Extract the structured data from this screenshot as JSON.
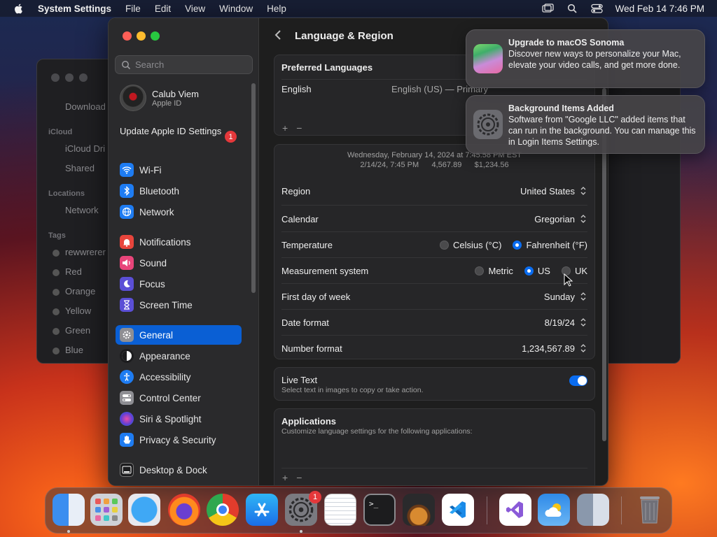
{
  "menubar": {
    "app_name": "System Settings",
    "menus": [
      "File",
      "Edit",
      "View",
      "Window",
      "Help"
    ],
    "datetime": "Wed Feb 14  7:46 PM"
  },
  "finder": {
    "items": [
      "Download",
      "iCloud Dri",
      "Shared",
      "Network"
    ],
    "sections": [
      "iCloud",
      "Locations",
      "Tags"
    ],
    "tags": [
      "rewwrerer",
      "Red",
      "Orange",
      "Yellow",
      "Green",
      "Blue"
    ]
  },
  "sidebar": {
    "search_placeholder": "Search",
    "profile": {
      "name": "Calub Viem",
      "sub": "Apple ID"
    },
    "update": {
      "label": "Update Apple ID Settings",
      "badge": "1"
    },
    "items": [
      {
        "label": "Wi-Fi",
        "icon": "wifi-icon",
        "color": "#1e7cf2"
      },
      {
        "label": "Bluetooth",
        "icon": "bluetooth-icon",
        "color": "#1e7cf2"
      },
      {
        "label": "Network",
        "icon": "globe-icon",
        "color": "#1e7cf2"
      },
      {
        "label": "Notifications",
        "icon": "bell-icon",
        "color": "#e8453c"
      },
      {
        "label": "Sound",
        "icon": "speaker-icon",
        "color": "#e8457a"
      },
      {
        "label": "Focus",
        "icon": "moon-icon",
        "color": "#5b4fd6"
      },
      {
        "label": "Screen Time",
        "icon": "hourglass-icon",
        "color": "#5b4fd6"
      },
      {
        "label": "General",
        "icon": "gear-icon",
        "color": "#8e8e93"
      },
      {
        "label": "Appearance",
        "icon": "appearance-icon",
        "color": "#1c1c1e"
      },
      {
        "label": "Accessibility",
        "icon": "accessibility-icon",
        "color": "#1e7cf2"
      },
      {
        "label": "Control Center",
        "icon": "toggles-icon",
        "color": "#8e8e93"
      },
      {
        "label": "Siri & Spotlight",
        "icon": "siri-icon",
        "color": "#6a3fd1"
      },
      {
        "label": "Privacy & Security",
        "icon": "hand-icon",
        "color": "#1e7cf2"
      },
      {
        "label": "Desktop & Dock",
        "icon": "dock-icon",
        "color": "#1c1c1e"
      }
    ],
    "selected": "General"
  },
  "content": {
    "title": "Language & Region",
    "preferred_languages": {
      "heading": "Preferred Languages",
      "language": "English",
      "language_detail": "English (US) — Primary"
    },
    "preview": {
      "line1": "Wednesday, February 14, 2024 at 7:45:58 PM EST",
      "line2": "2/14/24, 7:45 PM      4,567.89      $1,234.56"
    },
    "rows": {
      "region": {
        "label": "Region",
        "value": "United States"
      },
      "calendar": {
        "label": "Calendar",
        "value": "Gregorian"
      },
      "temperature": {
        "label": "Temperature",
        "options": [
          "Celsius (°C)",
          "Fahrenheit (°F)"
        ],
        "selected": "Fahrenheit (°F)"
      },
      "measurement": {
        "label": "Measurement system",
        "options": [
          "Metric",
          "US",
          "UK"
        ],
        "selected": "US"
      },
      "first_day": {
        "label": "First day of week",
        "value": "Sunday"
      },
      "date_format": {
        "label": "Date format",
        "value": "8/19/24"
      },
      "number_format": {
        "label": "Number format",
        "value": "1,234,567.89"
      }
    },
    "live_text": {
      "title": "Live Text",
      "desc": "Select text in images to copy or take action.",
      "enabled": true
    },
    "applications": {
      "title": "Applications",
      "desc": "Customize language settings for the following applications:"
    },
    "plus": "+",
    "minus": "−"
  },
  "notifications": [
    {
      "title": "Upgrade to macOS Sonoma",
      "body": "Discover new ways to personalize your Mac, elevate your video calls, and get more done.",
      "icon": "sonoma-icon"
    },
    {
      "title": "Background Items Added",
      "body": "Software from \"Google LLC\" added items that can run in the background. You can manage this in Login Items Settings.",
      "icon": "settings-gear-icon"
    }
  ],
  "dock": {
    "apps": [
      "finder-icon",
      "launchpad-icon",
      "safari-icon",
      "firefox-icon",
      "chrome-icon",
      "app-store-icon",
      "system-settings-icon",
      "textedit-icon",
      "terminal-icon",
      "garageband-icon",
      "vscode-icon",
      "visual-studio-icon",
      "weather-icon",
      "preview-finder-icon",
      "trash-icon"
    ],
    "settings_badge": "1"
  }
}
